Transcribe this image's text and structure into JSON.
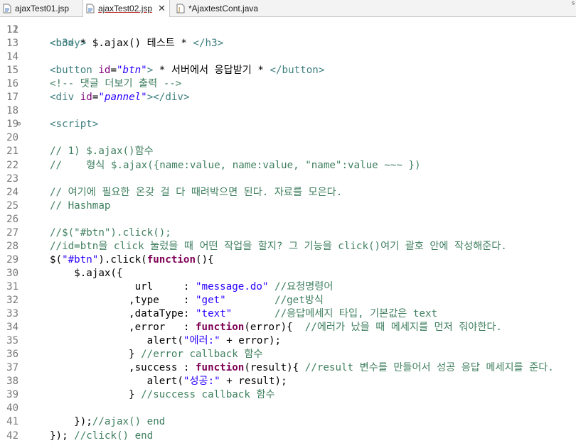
{
  "tabs": [
    {
      "label": "ajaxTest01.jsp",
      "icon": "jsp-file-icon",
      "active": false
    },
    {
      "label": "ajaxTest02.jsp",
      "icon": "jsp-file-icon",
      "active": true
    },
    {
      "label": "*AjaxtestCont.java",
      "icon": "java-file-icon",
      "active": false
    }
  ],
  "partial_line": {
    "number": "11",
    "text": "<body>"
  },
  "lines": [
    {
      "n": "12",
      "t": ""
    },
    {
      "n": "13",
      "t": "<h3> * $.ajax() 테스트 * </h3>"
    },
    {
      "n": "14",
      "t": ""
    },
    {
      "n": "15",
      "t": "<button id=\"btn\"> * 서버에서 응답받기 * </button>"
    },
    {
      "n": "16",
      "t": "<!-- 댓글 더보기 출력 -->"
    },
    {
      "n": "17",
      "t": "<div id=\"pannel\"></div>"
    },
    {
      "n": "18",
      "t": ""
    },
    {
      "n": "19",
      "t": "<script>"
    },
    {
      "n": "20",
      "t": ""
    },
    {
      "n": "21",
      "t": "// 1) $.ajax()함수"
    },
    {
      "n": "22",
      "t": "//    형식 $.ajax({name:value, name:value, \"name\":value ~~~ })"
    },
    {
      "n": "23",
      "t": ""
    },
    {
      "n": "24",
      "t": "// 여기에 필요한 온갖 걸 다 때려박으면 된다. 자료를 모은다."
    },
    {
      "n": "25",
      "t": "// Hashmap"
    },
    {
      "n": "26",
      "t": ""
    },
    {
      "n": "27",
      "t": "//$(\"#btn\").click();"
    },
    {
      "n": "28",
      "t": "//id=btn을 click 눌렀을 때 어떤 작업을 할지? 그 기능을 click()여기 괄호 안에 작성해준다."
    },
    {
      "n": "29",
      "t": "$(\"#btn\").click(function(){"
    },
    {
      "n": "30",
      "t": "    $.ajax({"
    },
    {
      "n": "31",
      "t": "              url     : \"message.do\" //요청명령어"
    },
    {
      "n": "32",
      "t": "             ,type    : \"get\"        //get방식"
    },
    {
      "n": "33",
      "t": "             ,dataType: \"text\"       //응답메세지 타입, 기본값은 text"
    },
    {
      "n": "34",
      "t": "             ,error   : function(error){  //에러가 났을 때 메세지를 먼저 줘야한다."
    },
    {
      "n": "35",
      "t": "                alert(\"에러:\" + error);"
    },
    {
      "n": "36",
      "t": "             } //error callback 함수"
    },
    {
      "n": "37",
      "t": "             ,success : function(result){ //result 변수를 만들어서 성공 응답 메세지를 준다."
    },
    {
      "n": "38",
      "t": "                alert(\"성공:\" + result);"
    },
    {
      "n": "39",
      "t": "             } //success callback 함수"
    },
    {
      "n": "40",
      "t": ""
    },
    {
      "n": "41",
      "t": "    });//ajax() end"
    },
    {
      "n": "42",
      "t": "}); //click() end"
    }
  ],
  "fold_marker_line": "19",
  "colors": {
    "keyword": "#7f0055",
    "string": "#2a00ff",
    "comment": "#3f7f5f",
    "tag": "#3f7f7f",
    "attribute": "#7f007f",
    "line_number": "#787878"
  }
}
